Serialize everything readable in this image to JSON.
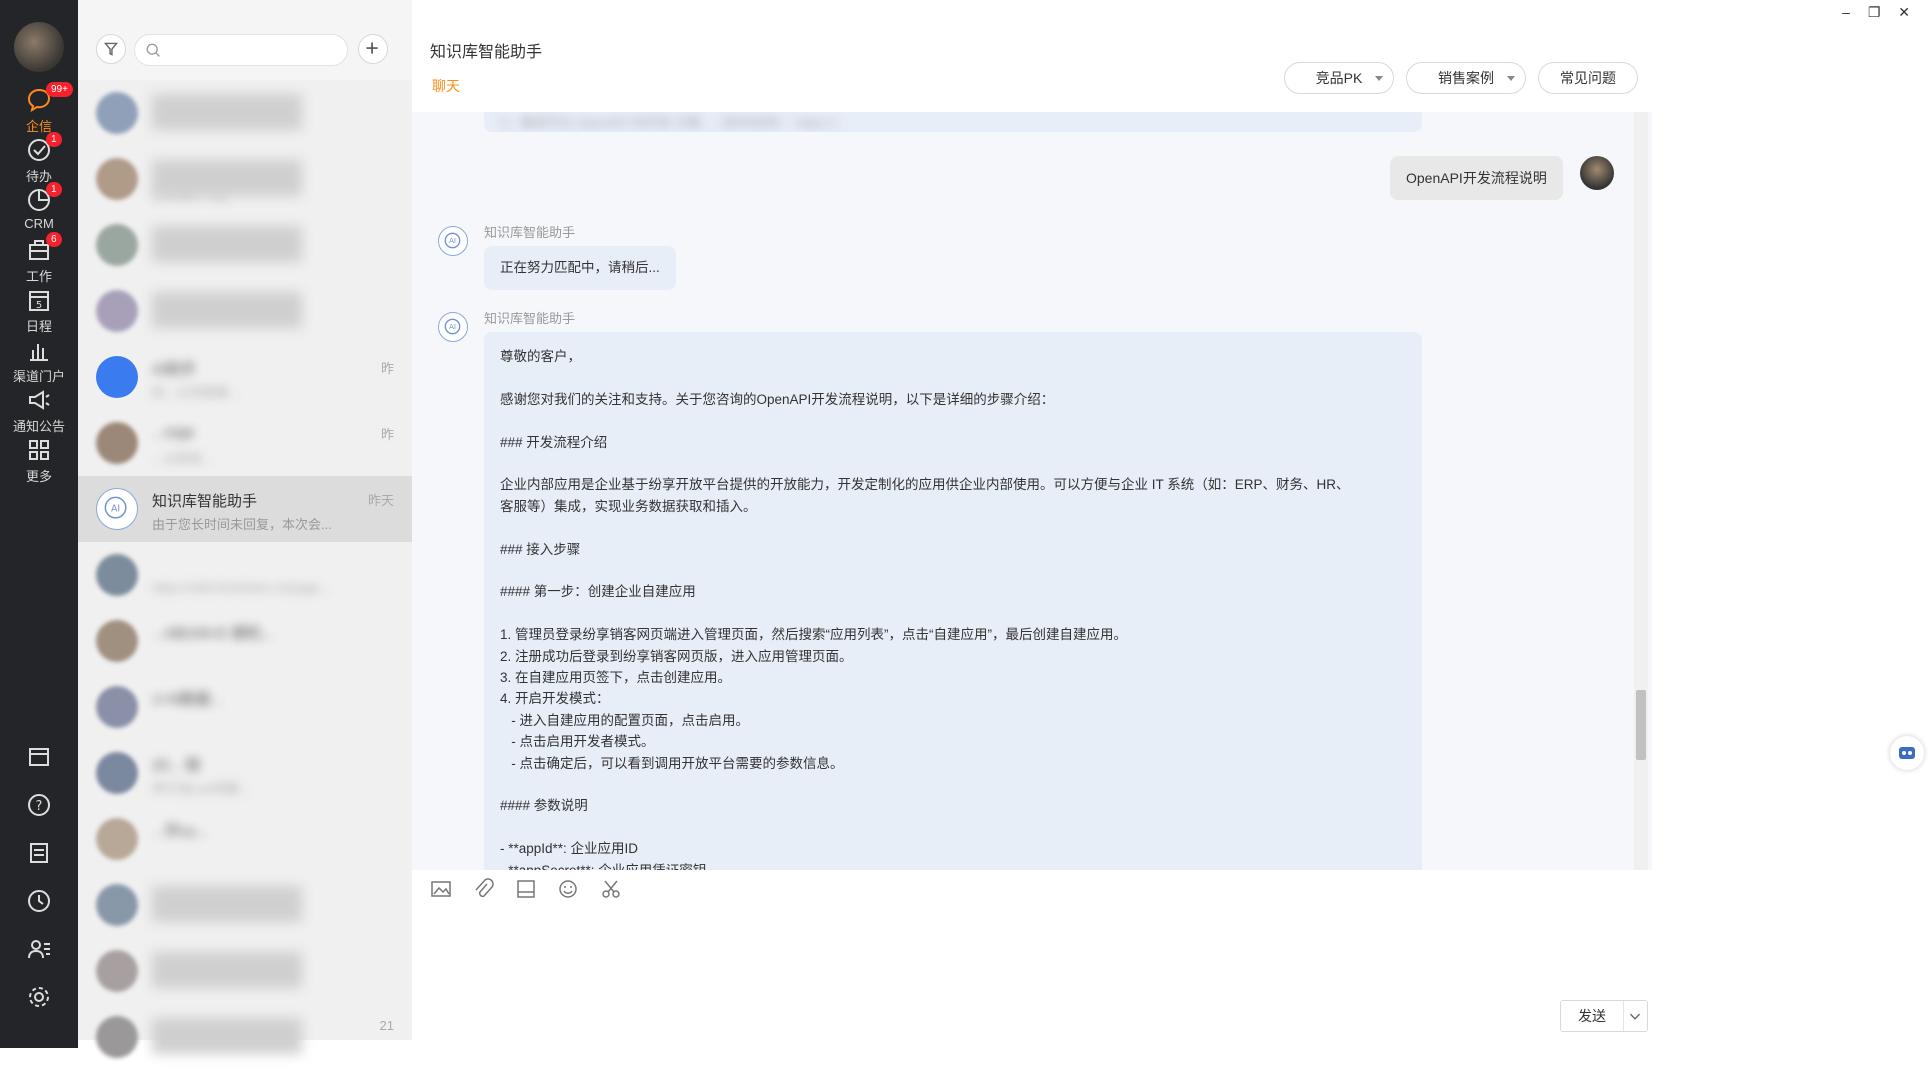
{
  "nav": {
    "items": [
      {
        "label": "企信",
        "badge": "99+",
        "icon": "chat-bubble-icon",
        "active": true
      },
      {
        "label": "待办",
        "badge": "1",
        "icon": "check-circle-icon"
      },
      {
        "label": "CRM",
        "badge": "1",
        "icon": "pie-chart-icon"
      },
      {
        "label": "工作",
        "badge": "6",
        "icon": "briefcase-icon"
      },
      {
        "label": "日程",
        "badge": "",
        "icon": "calendar-icon",
        "day": "5"
      },
      {
        "label": "渠道门户",
        "badge": "",
        "icon": "bar-chart-icon"
      },
      {
        "label": "通知公告",
        "badge": "",
        "icon": "megaphone-icon"
      },
      {
        "label": "更多",
        "badge": "",
        "icon": "grid-icon"
      }
    ],
    "bottom_icons": [
      "window-icon",
      "help-icon",
      "notepad-icon",
      "clock-icon",
      "contacts-icon",
      "settings-icon"
    ]
  },
  "list": {
    "search_placeholder": "",
    "conversations": [
      {
        "name": "",
        "preview": "",
        "time": "",
        "blurred": true
      },
      {
        "name": "",
        "preview": "让长会G..org",
        "time": "",
        "blurred": true
      },
      {
        "name": "",
        "preview": "",
        "time": "",
        "blurred": true
      },
      {
        "name": "",
        "preview": "",
        "time": "",
        "blurred": true
      },
      {
        "name": "AI助手",
        "preview": "的...公司有限...",
        "time": "昨",
        "blurred": false
      },
      {
        "name": "...orge",
        "preview": "...公告有...",
        "time": "昨",
        "blurred": false
      },
      {
        "name": "知识库智能助手",
        "preview": "由于您长时间未回复，本次会...",
        "time": "昨天",
        "selected": true
      },
      {
        "name": "",
        "preview": "https://wiki.firstshare.cn/page...",
        "time": "",
        "blurred": false
      },
      {
        "name": "...ABU04-E 建机...",
        "preview": "",
        "time": "",
        "blurred": false
      },
      {
        "name": "1+N数据...",
        "preview": "",
        "time": "",
        "blurred": false
      },
      {
        "name": "20... 程",
        "preview": "李子龙Lee向路...",
        "time": "",
        "blurred": false
      },
      {
        "name": "...宇xu...",
        "preview": "",
        "time": "",
        "blurred": false
      },
      {
        "name": "",
        "preview": "",
        "time": "",
        "blurred": true
      },
      {
        "name": "",
        "preview": "",
        "time": "",
        "blurred": true
      },
      {
        "name": "",
        "preview": "",
        "time": "21",
        "blurred": true
      }
    ]
  },
  "chat": {
    "title": "知识库智能助手",
    "tab": "聊天",
    "buttons": {
      "pk": "竞品PK",
      "cases": "销售案例",
      "faq": "常见问题"
    },
    "window": {
      "min": "–",
      "restore": "❐",
      "close": "✕"
    },
    "top_fragment": "5：集成平台 OpenAPI 的开发 方案...（技术支持）：https://...",
    "user_message": "OpenAPI开发流程说明",
    "bot_name": "知识库智能助手",
    "bot_pending": "正在努力匹配中，请稍后...",
    "bot_answer": [
      "尊敬的客户，",
      "",
      "感谢您对我们的关注和支持。关于您咨询的OpenAPI开发流程说明，以下是详细的步骤介绍：",
      "",
      "### 开发流程介绍",
      "",
      "企业内部应用是企业基于纷享开放平台提供的开放能力，开发定制化的应用供企业内部使用。可以方便与企业 IT 系统（如：ERP、财务、HR、",
      "客服等）集成，实现业务数据获取和插入。",
      "",
      "### 接入步骤",
      "",
      "#### 第一步：创建企业自建应用",
      "",
      "1. 管理员登录纷享销客网页端进入管理页面，然后搜索“应用列表”，点击“自建应用”，最后创建自建应用。",
      "2. 注册成功后登录到纷享销客网页版，进入应用管理页面。",
      "3. 在自建应用页签下，点击创建应用。",
      "4. 开启开发模式：",
      "   - 进入自建应用的配置页面，点击启用。",
      "   - 点击启用开发者模式。",
      "   - 点击确定后，可以看到调用开放平台需要的参数信息。",
      "",
      "#### 参数说明",
      "",
      "- **appId**: 企业应用ID",
      "- **appSecret**: 企业应用凭证密钥"
    ],
    "send_label": "发送",
    "toolbar_icons": [
      "image-icon",
      "attachment-icon",
      "folder-icon",
      "emoji-icon",
      "scissors-icon"
    ]
  },
  "colors": {
    "accent": "#ff8c1a",
    "nav_bg": "#232529",
    "bubble": "#e8eef8",
    "badge": "#f5222d"
  }
}
